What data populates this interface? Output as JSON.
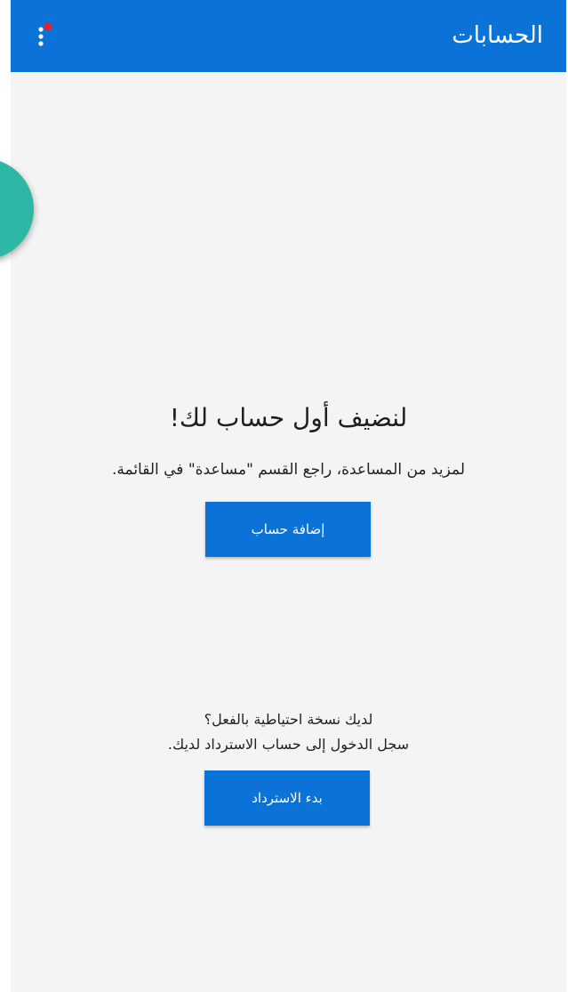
{
  "app_bar": {
    "title": "الحسابات",
    "menu_icon": "overflow-menu-icon",
    "notification_dot_color": "#e8202a",
    "color": "#0b72d8"
  },
  "fab": {
    "icon": "add-icon",
    "color": "#2db7a4"
  },
  "empty_state": {
    "heading": "لنضيف أول حساب لك!",
    "help_text": "لمزيد من المساعدة، راجع القسم \"مساعدة\" في القائمة.",
    "add_account_label": "إضافة حساب"
  },
  "restore": {
    "question": "لديك نسخة احتياطية بالفعل؟",
    "instruction": "سجل الدخول إلى حساب الاسترداد لديك.",
    "start_label": "بدء الاسترداد"
  }
}
